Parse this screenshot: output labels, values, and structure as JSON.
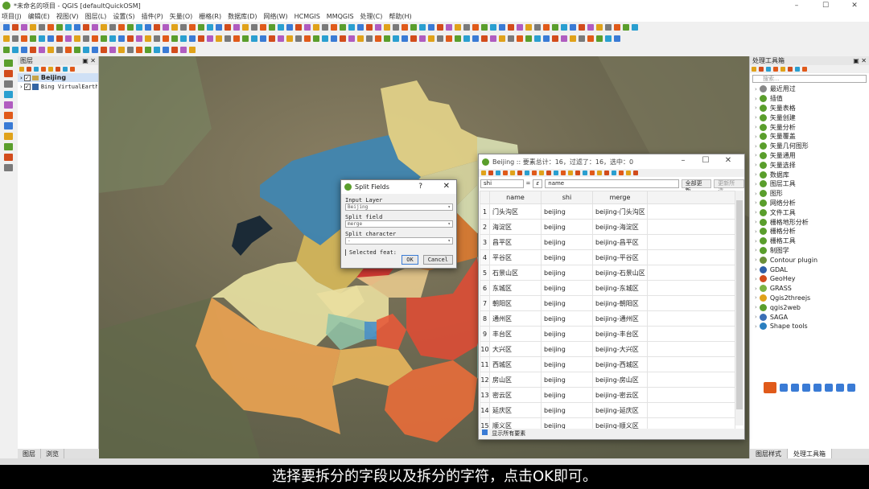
{
  "window": {
    "title": "*未命名的项目 - QGIS [defaultQuickOSM]"
  },
  "menubar": [
    "项目(J)",
    "编辑(E)",
    "视图(V)",
    "图层(L)",
    "设置(S)",
    "插件(P)",
    "矢量(O)",
    "栅格(R)",
    "数据库(D)",
    "网络(W)",
    "HCMGIS",
    "MMQGIS",
    "处理(C)",
    "帮助(H)"
  ],
  "layers_panel": {
    "title": "图层",
    "layers": [
      {
        "name": "Beijing",
        "checked": true
      },
      {
        "name": "Bing VirtualEarth",
        "checked": true
      }
    ],
    "tabs": [
      "图层",
      "浏览"
    ]
  },
  "processing_panel": {
    "title": "处理工具箱",
    "search_placeholder": "搜索...",
    "items": [
      {
        "label": "最近用过",
        "icon": "clock-icon",
        "color": "#888888"
      },
      {
        "label": "插值",
        "icon": "qgis-icon",
        "color": "#5a9e2c"
      },
      {
        "label": "矢量表格",
        "icon": "qgis-icon",
        "color": "#5a9e2c"
      },
      {
        "label": "矢量创建",
        "icon": "qgis-icon",
        "color": "#5a9e2c"
      },
      {
        "label": "矢量分析",
        "icon": "qgis-icon",
        "color": "#5a9e2c"
      },
      {
        "label": "矢量覆盖",
        "icon": "qgis-icon",
        "color": "#5a9e2c"
      },
      {
        "label": "矢量几何图形",
        "icon": "qgis-icon",
        "color": "#5a9e2c"
      },
      {
        "label": "矢量通用",
        "icon": "qgis-icon",
        "color": "#5a9e2c"
      },
      {
        "label": "矢量选择",
        "icon": "qgis-icon",
        "color": "#5a9e2c"
      },
      {
        "label": "数据库",
        "icon": "qgis-icon",
        "color": "#5a9e2c"
      },
      {
        "label": "图层工具",
        "icon": "qgis-icon",
        "color": "#5a9e2c"
      },
      {
        "label": "图形",
        "icon": "qgis-icon",
        "color": "#5a9e2c"
      },
      {
        "label": "网络分析",
        "icon": "qgis-icon",
        "color": "#5a9e2c"
      },
      {
        "label": "文件工具",
        "icon": "qgis-icon",
        "color": "#5a9e2c"
      },
      {
        "label": "栅格地形分析",
        "icon": "qgis-icon",
        "color": "#5a9e2c"
      },
      {
        "label": "栅格分析",
        "icon": "qgis-icon",
        "color": "#5a9e2c"
      },
      {
        "label": "栅格工具",
        "icon": "qgis-icon",
        "color": "#5a9e2c"
      },
      {
        "label": "制图学",
        "icon": "qgis-icon",
        "color": "#5a9e2c"
      },
      {
        "label": "Contour plugin",
        "icon": "contour-icon",
        "color": "#6b8e3a"
      },
      {
        "label": "GDAL",
        "icon": "gdal-icon",
        "color": "#2f5fa8"
      },
      {
        "label": "GeoHey",
        "icon": "geohey-icon",
        "color": "#d24c1c"
      },
      {
        "label": "GRASS",
        "icon": "grass-icon",
        "color": "#7cb342"
      },
      {
        "label": "Qgis2threejs",
        "icon": "threejs-icon",
        "color": "#e0a21a"
      },
      {
        "label": "qgis2web",
        "icon": "qgis2web-icon",
        "color": "#5a9e2c"
      },
      {
        "label": "SAGA",
        "icon": "saga-icon",
        "color": "#3b6fb6"
      },
      {
        "label": "Shape tools",
        "icon": "shape-tools-icon",
        "color": "#2a7fc0"
      }
    ],
    "tabs": [
      "图层样式",
      "处理工具箱"
    ]
  },
  "attribute_table": {
    "title": "Beijing :: 要素总计：16，过滤了：16，选中：0",
    "field_select": "shi",
    "expression": "name",
    "update_all": "全部更新",
    "update_selected": "更新所选",
    "columns": [
      "name",
      "shi",
      "merge"
    ],
    "rows": [
      [
        "1",
        "门头沟区",
        "beijing",
        "beijing-门头沟区"
      ],
      [
        "2",
        "海淀区",
        "beijing",
        "beijing-海淀区"
      ],
      [
        "3",
        "昌平区",
        "beijing",
        "beijing-昌平区"
      ],
      [
        "4",
        "平谷区",
        "beijing",
        "beijing-平谷区"
      ],
      [
        "5",
        "石景山区",
        "beijing",
        "beijing-石景山区"
      ],
      [
        "6",
        "东城区",
        "beijing",
        "beijing-东城区"
      ],
      [
        "7",
        "朝阳区",
        "beijing",
        "beijing-朝阳区"
      ],
      [
        "8",
        "通州区",
        "beijing",
        "beijing-通州区"
      ],
      [
        "9",
        "丰台区",
        "beijing",
        "beijing-丰台区"
      ],
      [
        "10",
        "大兴区",
        "beijing",
        "beijing-大兴区"
      ],
      [
        "11",
        "西城区",
        "beijing",
        "beijing-西城区"
      ],
      [
        "12",
        "房山区",
        "beijing",
        "beijing-房山区"
      ],
      [
        "13",
        "密云区",
        "beijing",
        "beijing-密云区"
      ],
      [
        "14",
        "延庆区",
        "beijing",
        "beijing-延庆区"
      ],
      [
        "15",
        "顺义区",
        "beijing",
        "beijing-顺义区"
      ]
    ],
    "footer": "显示所有要素"
  },
  "split_dialog": {
    "title": "Split Fields",
    "help": "?",
    "input_layer_label": "Input Layer",
    "input_layer_value": "Beijing",
    "split_field_label": "Split field",
    "split_field_value": "merge",
    "split_char_label": "Split character",
    "split_char_value": "-",
    "selected_label": "Selected feat:",
    "ok": "OK",
    "cancel": "Cancel"
  },
  "subtitle": "选择要拆分的字段以及拆分的字符，点击OK即可。",
  "colors": {
    "accent": "#3a7bd5",
    "qgis_green": "#5a9e2c"
  }
}
